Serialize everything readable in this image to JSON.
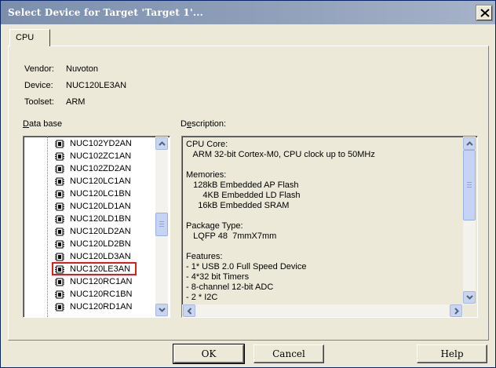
{
  "window": {
    "title": "Select Device for Target 'Target 1'..."
  },
  "tabs": [
    {
      "label": "CPU"
    }
  ],
  "info": {
    "vendor_label": "Vendor:",
    "vendor_value": "Nuvoton",
    "device_label": "Device:",
    "device_value": "NUC120LE3AN",
    "toolset_label": "Toolset:",
    "toolset_value": "ARM"
  },
  "database": {
    "label_accel": "D",
    "label_rest": "ata base",
    "items": [
      "NUC102YD2AN",
      "NUC102ZC1AN",
      "NUC102ZD2AN",
      "NUC120LC1AN",
      "NUC120LC1BN",
      "NUC120LD1AN",
      "NUC120LD1BN",
      "NUC120LD2AN",
      "NUC120LD2BN",
      "NUC120LD3AN",
      "NUC120LE3AN",
      "NUC120RC1AN",
      "NUC120RC1BN",
      "NUC120RD1AN"
    ],
    "selected": "NUC120LE3AN"
  },
  "description": {
    "label_start": "D",
    "label_accel": "e",
    "label_rest": "scription:",
    "lines": [
      "CPU Core:",
      "   ARM 32-bit Cortex-M0, CPU clock up to 50MHz",
      "",
      "Memories:",
      "   128kB Embedded AP Flash",
      "       4KB Embedded LD Flash",
      "     16kB Embedded SRAM",
      "",
      "Package Type:",
      "   LQFP 48  7mmX7mm",
      "",
      "Features:",
      "- 1* USB 2.0 Full Speed Device",
      "- 4*32 bit Timers",
      "- 8-channel 12-bit ADC",
      "- 2 * I2C"
    ]
  },
  "buttons": {
    "ok": "OK",
    "cancel": "Cancel",
    "help": "Help"
  }
}
